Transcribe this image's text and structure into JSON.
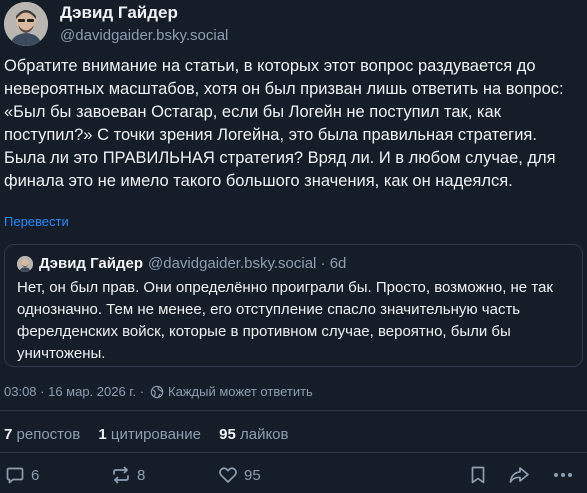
{
  "author": {
    "name": "Дэвид Гайдер",
    "handle": "@davidgaider.bsky.social"
  },
  "post": {
    "text": "Обратите внимание на статьи, в которых этот вопрос раздувается до невероятных масштабов, хотя он был призван лишь ответить на вопрос: «Был бы завоеван Остагар, если бы Логейн не поступил так, как поступил?» С точки зрения Логейна, это была правильная стратегия. Была ли это ПРАВИЛЬНАЯ стратегия? Вряд ли. И в любом случае, для финала это не имело такого большого значения, как он надеялся.",
    "translate_label": "Перевести"
  },
  "quote": {
    "name": "Дэвид Гайдер",
    "handle_time": "@davidgaider.bsky.social · 6d",
    "text": "Нет, он был прав. Они определённо проиграли бы. Просто, возможно, не так однозначно. Тем не менее, его отступление спасло значительную часть ферелденских войск, которые в противном случае, вероятно, были бы уничтожены."
  },
  "meta": {
    "timestamp": "03:08 · 16 мар. 2026 г. ·",
    "reply_setting": "Каждый может ответить"
  },
  "stats": {
    "reposts_count": "7",
    "reposts_label": "репостов",
    "quotes_count": "1",
    "quotes_label": "цитирование",
    "likes_count": "95",
    "likes_label": "лайков"
  },
  "actions": {
    "reply_count": "6",
    "repost_count": "8",
    "like_count": "95",
    "icons": [
      "reply-icon",
      "repost-icon",
      "like-icon",
      "bookmark-icon",
      "share-icon",
      "more-icon"
    ]
  },
  "colors": {
    "background": "#151d28",
    "text": "#f1f3f5",
    "muted": "#8d9eb2",
    "link": "#208bfe",
    "border": "#2e3a4a"
  }
}
